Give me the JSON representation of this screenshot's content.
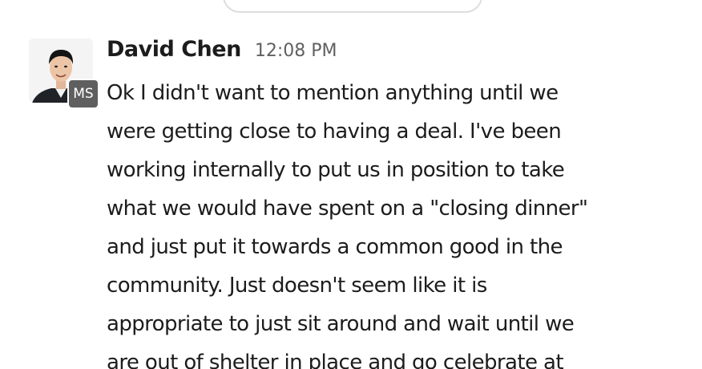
{
  "date_divider": {
    "label": ""
  },
  "message": {
    "sender": "David Chen",
    "timestamp": "12:08 PM",
    "badge": "MS",
    "avatar_icon": "person-photo-icon",
    "lines": [
      "Ok I didn't want to mention anything until we",
      "were getting close to having a deal.  I've been",
      "working internally to put us in position to take",
      "what we would have spent on a \"closing dinner\"",
      "and just put it towards a common good in the",
      "community.  Just doesn't seem like it is",
      "appropriate to just sit around and wait until we",
      "are out of shelter in place and go celebrate at"
    ]
  },
  "colors": {
    "text": "#1d1c1d",
    "muted": "#616061",
    "badge_bg": "#5f5f5f",
    "divider_border": "#dddddd"
  }
}
